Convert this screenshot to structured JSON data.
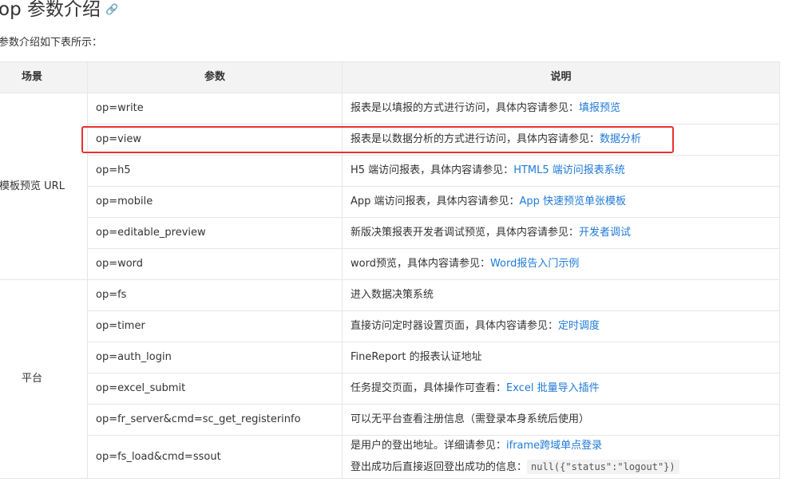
{
  "title": "op 参数介绍",
  "anchor_icon": "link-icon",
  "intro": "参数介绍如下表所示：",
  "headers": {
    "scene": "场景",
    "param": "参数",
    "desc": "说明"
  },
  "groups": {
    "template": "模板预览 URL",
    "platform": "平台"
  },
  "rows": [
    {
      "param": "op=write",
      "desc": "报表是以填报的方式进行访问，具体内容请参见：",
      "link": "填报预览"
    },
    {
      "param": "op=view",
      "desc": "报表是以数据分析的方式进行访问，具体内容请参见：",
      "link": "数据分析"
    },
    {
      "param": "op=h5",
      "desc": "H5 端访问报表，具体内容请参见：",
      "link": "HTML5 端访问报表系统"
    },
    {
      "param": "op=mobile",
      "desc": "App 端访问报表，具体内容请参见：",
      "link": "App 快速预览单张模板"
    },
    {
      "param": "op=editable_preview",
      "desc": "新版决策报表开发者调试预览，具体内容请参见：",
      "link": "开发者调试"
    },
    {
      "param": "op=word",
      "desc": "word预览，具体内容请参见：",
      "link": "Word报告入门示例"
    },
    {
      "param": "op=fs",
      "desc": "进入数据决策系统",
      "link": ""
    },
    {
      "param": "op=timer",
      "desc": "直接访问定时器设置页面，具体内容请参见：",
      "link": "定时调度"
    },
    {
      "param": "op=auth_login",
      "desc": " FineReport 的报表认证地址",
      "link": ""
    },
    {
      "param": "op=excel_submit",
      "desc": "任务提交页面，具体操作可查看：",
      "link": "Excel 批量导入插件"
    },
    {
      "param": "op=fr_server&cmd=sc_get_registerinfo",
      "desc": "可以无平台查看注册信息（需登录本身系统后使用）",
      "link": ""
    },
    {
      "param": "op=fs_load&cmd=ssout",
      "desc": "是用户的登出地址。详细请参见：",
      "link": "iframe跨域单点登录",
      "desc2": "登出成功后直接返回登出成功的信息：",
      "code": "null({\"status\":\"logout\"})"
    }
  ]
}
